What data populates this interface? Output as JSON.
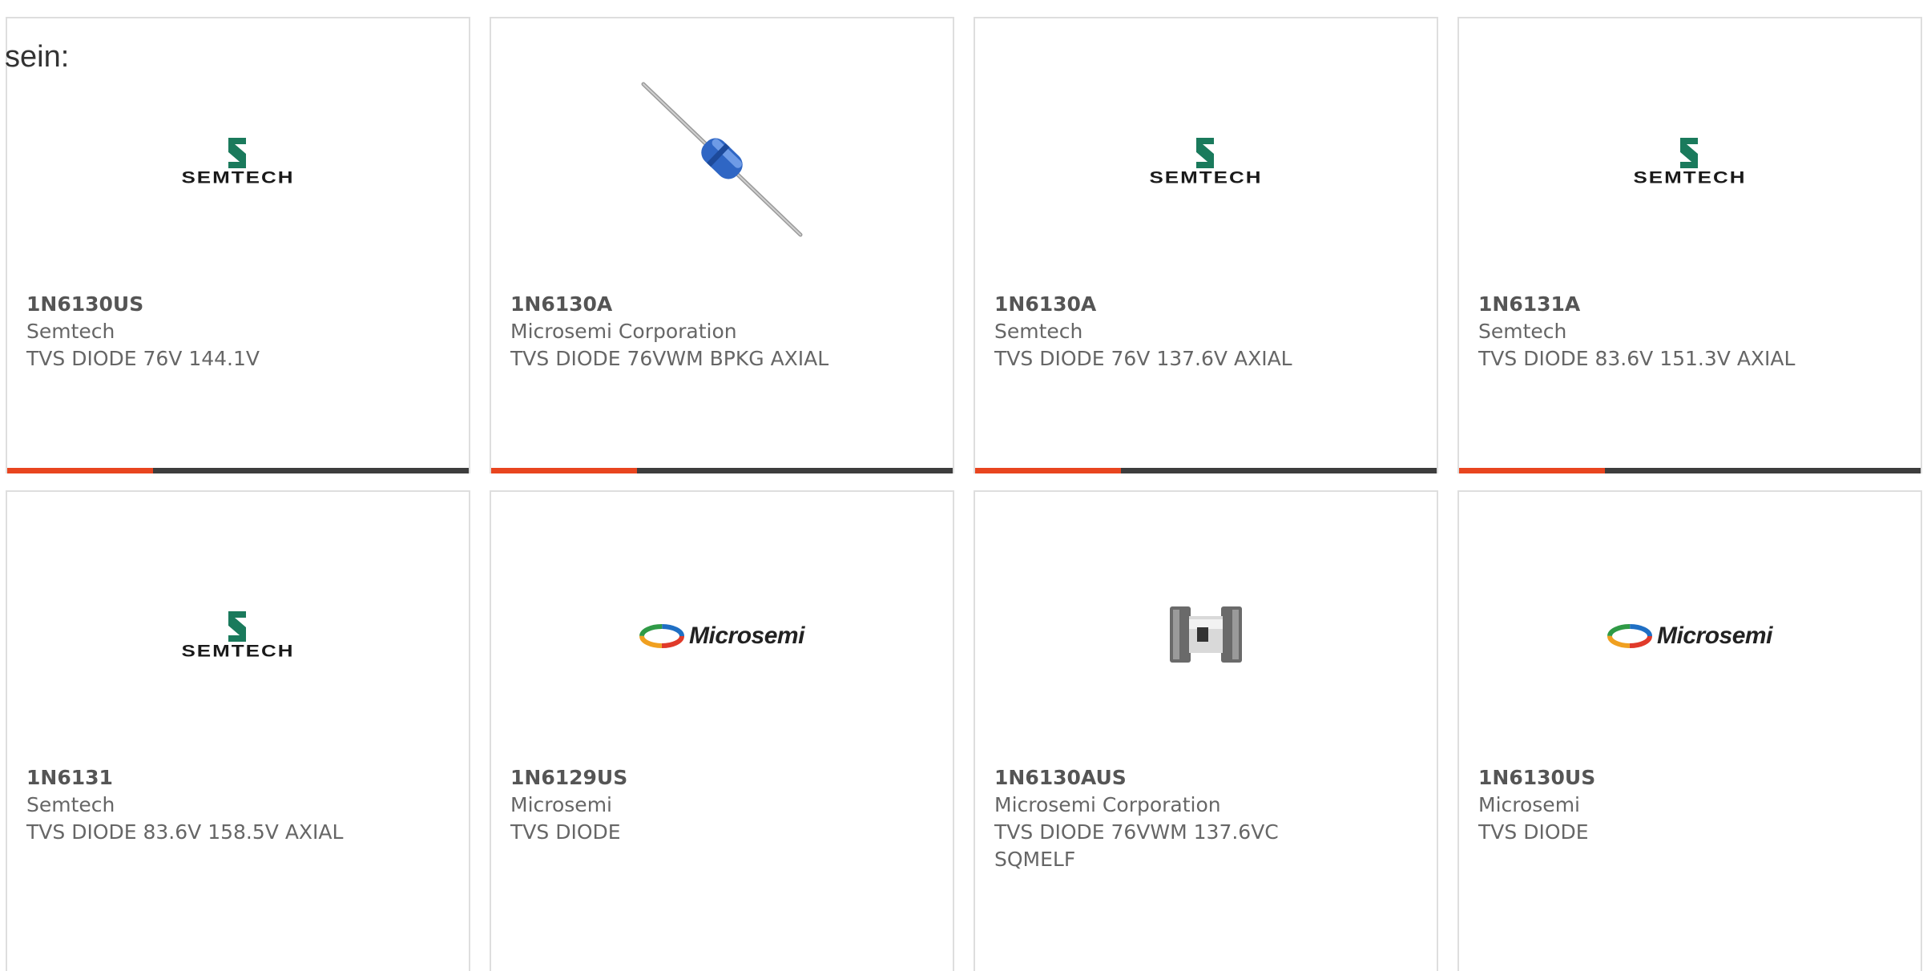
{
  "overlay_text": "sein:",
  "colors": {
    "accent_bar": "#e8451f",
    "dark_bar": "#3d3d3d",
    "card_border": "#dedede",
    "text": "#666666"
  },
  "products": [
    {
      "part": "1N6130US",
      "manufacturer": "Semtech",
      "description": "TVS DIODE 76V 144.1V",
      "image": "semtech-logo",
      "logo_text": "SEMTECH"
    },
    {
      "part": "1N6130A",
      "manufacturer": "Microsemi Corporation",
      "description": "TVS DIODE 76VWM BPKG AXIAL",
      "image": "axial-diode-photo"
    },
    {
      "part": "1N6130A",
      "manufacturer": "Semtech",
      "description": "TVS DIODE 76V 137.6V AXIAL",
      "image": "semtech-logo",
      "logo_text": "SEMTECH"
    },
    {
      "part": "1N6131A",
      "manufacturer": "Semtech",
      "description": "TVS DIODE 83.6V 151.3V AXIAL",
      "image": "semtech-logo",
      "logo_text": "SEMTECH"
    },
    {
      "part": "1N6131",
      "manufacturer": "Semtech",
      "description": "TVS DIODE 83.6V 158.5V AXIAL",
      "image": "semtech-logo",
      "logo_text": "SEMTECH"
    },
    {
      "part": "1N6129US",
      "manufacturer": "Microsemi",
      "description": "TVS DIODE",
      "image": "microsemi-logo",
      "logo_text": "Microsemi"
    },
    {
      "part": "1N6130AUS",
      "manufacturer": "Microsemi Corporation",
      "description": "TVS DIODE 76VWM 137.6VC SQMELF",
      "image": "sqmelf-diode-photo"
    },
    {
      "part": "1N6130US",
      "manufacturer": "Microsemi",
      "description": "TVS DIODE",
      "image": "microsemi-logo",
      "logo_text": "Microsemi"
    }
  ]
}
